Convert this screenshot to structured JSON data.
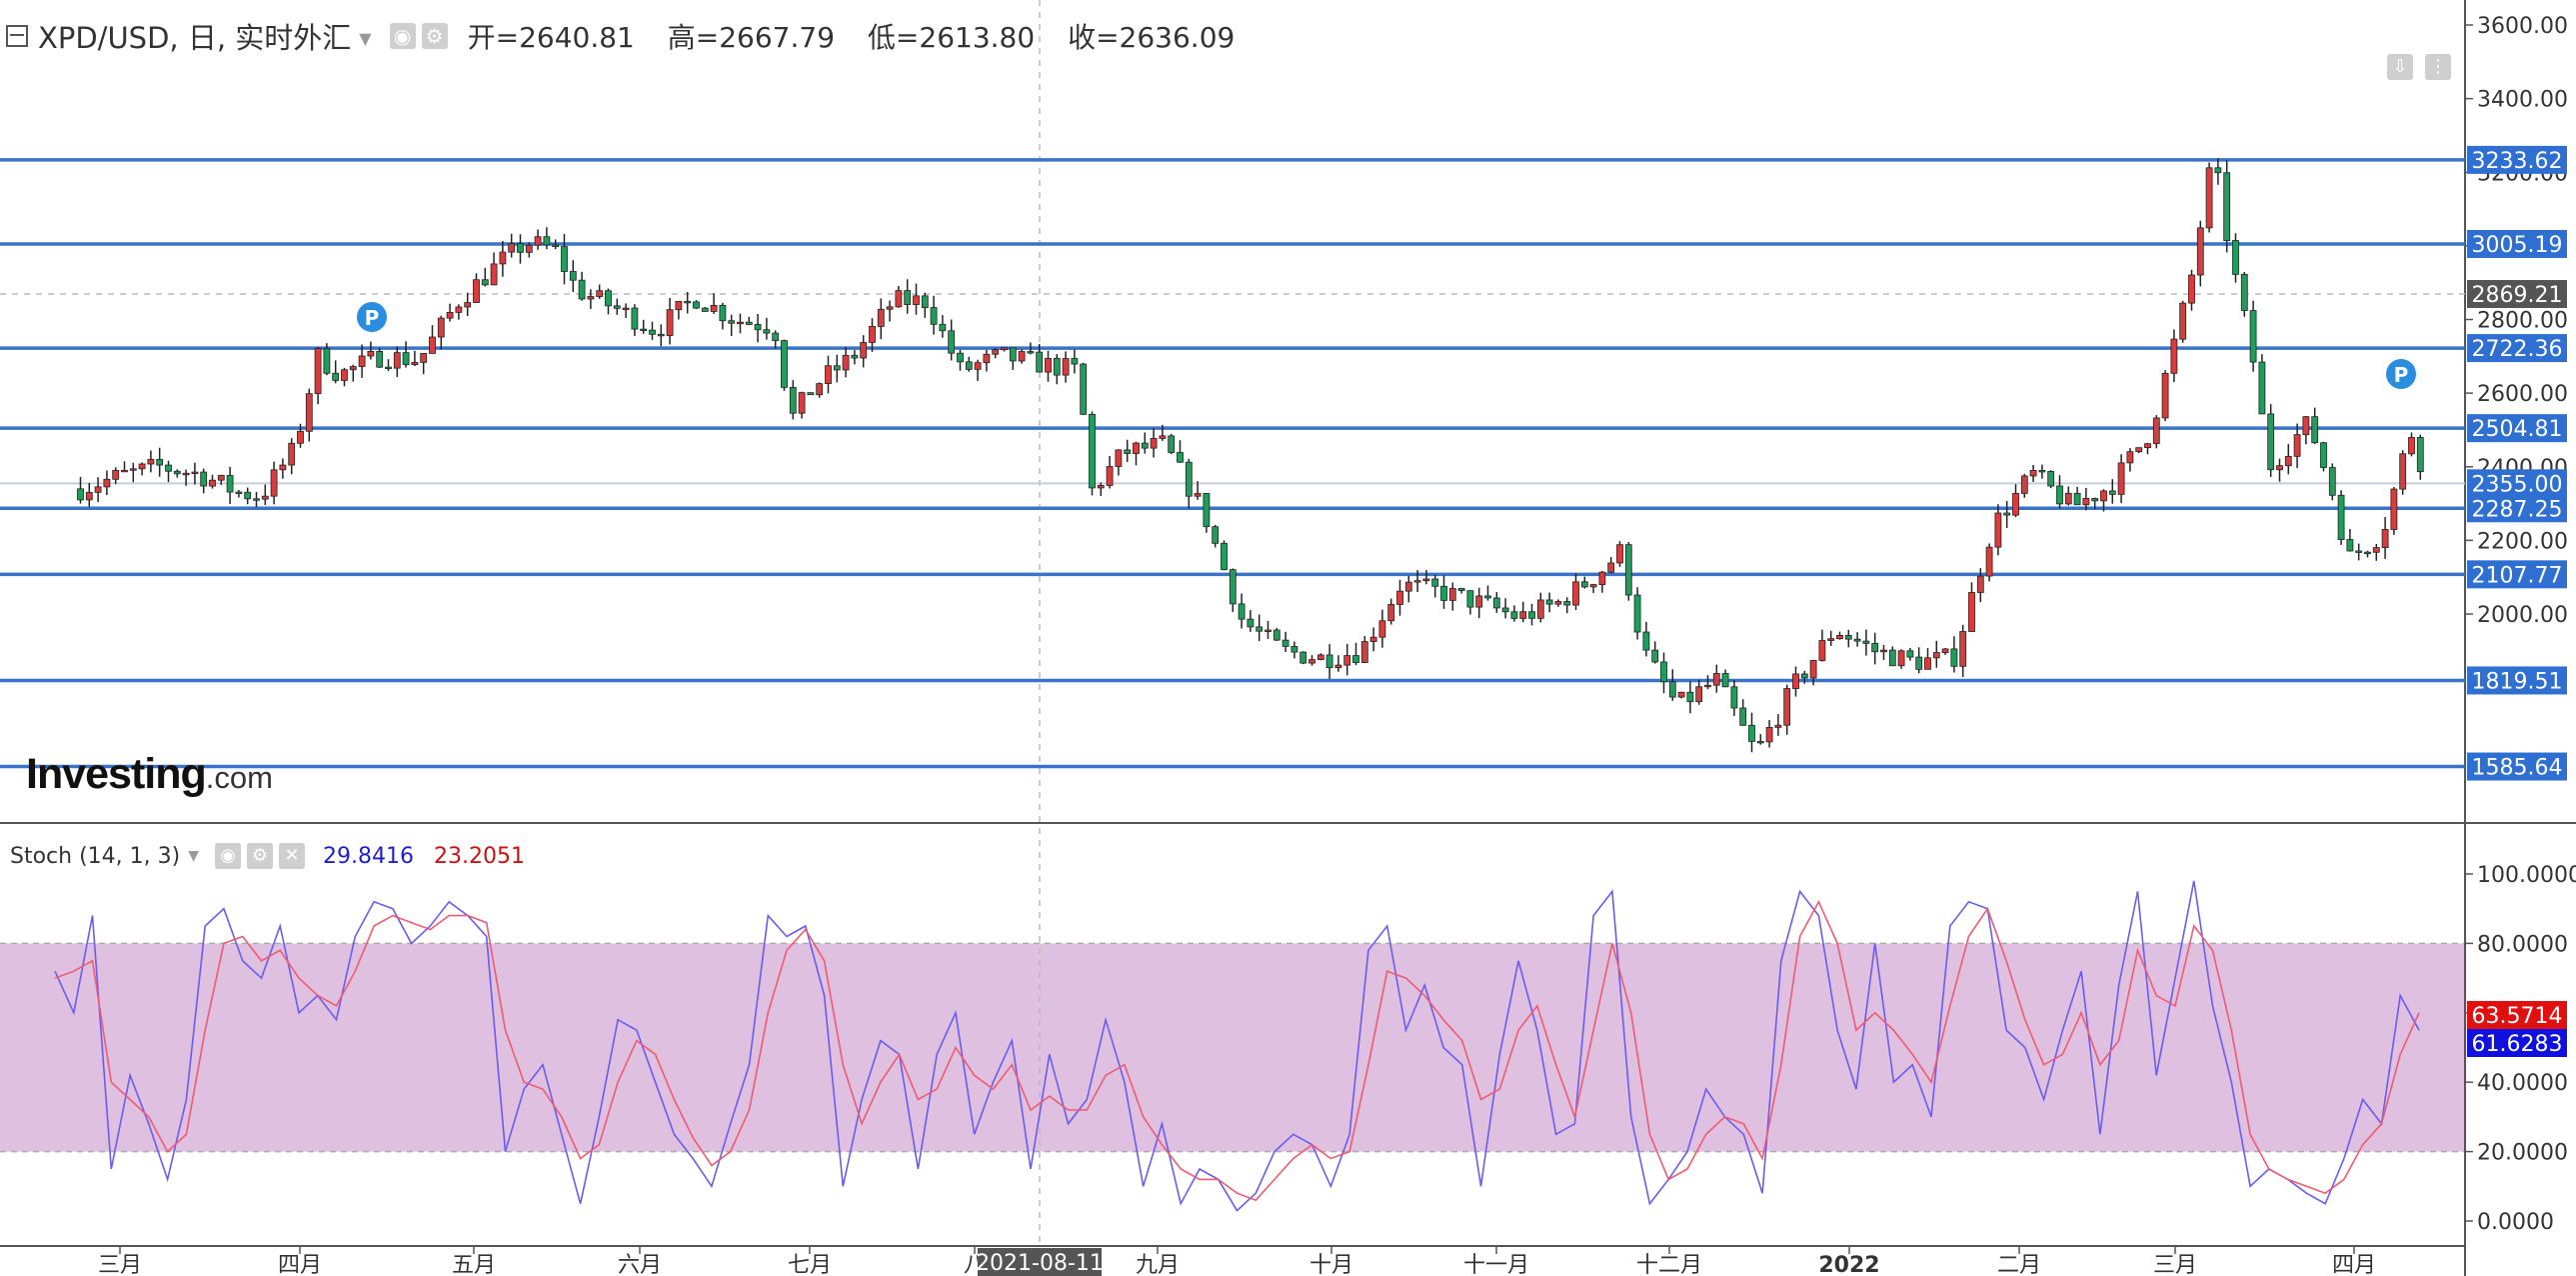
{
  "header": {
    "symbol": "XPD/USD, 日, 实时外汇",
    "open": "开=2640.81",
    "high": "高=2667.79",
    "low": "低=2613.80",
    "close": "收=2636.09"
  },
  "logo": {
    "brand": "Investing",
    "suffix": ".com"
  },
  "indicator": {
    "name": "Stoch (14, 1, 3)",
    "k_value": "29.8416",
    "d_value": "23.2051"
  },
  "crosshair_date": "2021-08-11",
  "colors": {
    "up": "#d93c3c",
    "down": "#1e9e5a",
    "support_line": "#3a73c9",
    "label_bg": "#2f6fd1",
    "k_line": "#6a5cf0",
    "d_line": "#ef5b70",
    "stoch_band": "#dfc0e0"
  },
  "chart_data": [
    {
      "type": "candlestick",
      "title": "XPD/USD, 日, 实时外汇",
      "ylim": [
        1500,
        3700
      ],
      "y_ticks": [
        2000,
        2200,
        2400,
        2600,
        2800,
        3000,
        3200,
        3400,
        3600
      ],
      "y_tick_labels": [
        "2000.00",
        "2200.00",
        "2400.00",
        "2600.00",
        "2800.00",
        "3000.00",
        "3200.00",
        "3400.00",
        "3600.00"
      ],
      "x_axis_labels": [
        "三月",
        "四月",
        "五月",
        "六月",
        "七月",
        "八",
        "九月",
        "十月",
        "十一月",
        "十二月",
        "2022",
        "二月",
        "三月",
        "四月"
      ],
      "horizontal_levels": [
        3233.62,
        3005.19,
        2722.36,
        2504.81,
        2287.25,
        2107.77,
        1819.51,
        1585.64
      ],
      "horizontal_level_labels": [
        "3233.62",
        "3005.19",
        "2722.36",
        "2504.81",
        "2287.25",
        "2107.77",
        "1819.51",
        "1585.64"
      ],
      "current_price": 2355.0,
      "current_price_label": "2355.00",
      "crosshair_price": 2869.21,
      "crosshair_price_label": "2869.21",
      "price_path": [
        {
          "date": "2021-02-22",
          "close": 2340
        },
        {
          "date": "2021-03-01",
          "close": 2375
        },
        {
          "date": "2021-03-08",
          "close": 2400
        },
        {
          "date": "2021-03-15",
          "close": 2380
        },
        {
          "date": "2021-03-22",
          "close": 2330
        },
        {
          "date": "2021-03-26",
          "close": 2320
        },
        {
          "date": "2021-04-01",
          "close": 2450
        },
        {
          "date": "2021-04-05",
          "close": 2700
        },
        {
          "date": "2021-04-09",
          "close": 2650
        },
        {
          "date": "2021-04-16",
          "close": 2700
        },
        {
          "date": "2021-04-23",
          "close": 2690
        },
        {
          "date": "2021-04-30",
          "close": 2850
        },
        {
          "date": "2021-05-07",
          "close": 2950
        },
        {
          "date": "2021-05-12",
          "close": 3010
        },
        {
          "date": "2021-05-17",
          "close": 2990
        },
        {
          "date": "2021-05-21",
          "close": 2880
        },
        {
          "date": "2021-05-28",
          "close": 2830
        },
        {
          "date": "2021-06-04",
          "close": 2770
        },
        {
          "date": "2021-06-11",
          "close": 2860
        },
        {
          "date": "2021-06-18",
          "close": 2800
        },
        {
          "date": "2021-06-25",
          "close": 2780
        },
        {
          "date": "2021-06-28",
          "close": 2530
        },
        {
          "date": "2021-07-02",
          "close": 2620
        },
        {
          "date": "2021-07-09",
          "close": 2700
        },
        {
          "date": "2021-07-16",
          "close": 2850
        },
        {
          "date": "2021-07-22",
          "close": 2850
        },
        {
          "date": "2021-07-28",
          "close": 2660
        },
        {
          "date": "2021-08-04",
          "close": 2700
        },
        {
          "date": "2021-08-11",
          "close": 2680
        },
        {
          "date": "2021-08-18",
          "close": 2660
        },
        {
          "date": "2021-08-20",
          "close": 2330
        },
        {
          "date": "2021-08-26",
          "close": 2440
        },
        {
          "date": "2021-09-02",
          "close": 2460
        },
        {
          "date": "2021-09-09",
          "close": 2280
        },
        {
          "date": "2021-09-16",
          "close": 1980
        },
        {
          "date": "2021-09-23",
          "close": 1900
        },
        {
          "date": "2021-09-30",
          "close": 1880
        },
        {
          "date": "2021-10-07",
          "close": 1900
        },
        {
          "date": "2021-10-14",
          "close": 2080
        },
        {
          "date": "2021-10-21",
          "close": 2060
        },
        {
          "date": "2021-10-28",
          "close": 2030
        },
        {
          "date": "2021-11-04",
          "close": 1990
        },
        {
          "date": "2021-11-11",
          "close": 2030
        },
        {
          "date": "2021-11-18",
          "close": 2110
        },
        {
          "date": "2021-11-22",
          "close": 2170
        },
        {
          "date": "2021-11-26",
          "close": 1900
        },
        {
          "date": "2021-12-02",
          "close": 1750
        },
        {
          "date": "2021-12-09",
          "close": 1820
        },
        {
          "date": "2021-12-16",
          "close": 1620
        },
        {
          "date": "2021-12-23",
          "close": 1810
        },
        {
          "date": "2021-12-30",
          "close": 1960
        },
        {
          "date": "2022-01-06",
          "close": 1900
        },
        {
          "date": "2022-01-13",
          "close": 1870
        },
        {
          "date": "2022-01-20",
          "close": 1880
        },
        {
          "date": "2022-01-27",
          "close": 2240
        },
        {
          "date": "2022-02-03",
          "close": 2380
        },
        {
          "date": "2022-02-10",
          "close": 2290
        },
        {
          "date": "2022-02-17",
          "close": 2350
        },
        {
          "date": "2022-02-24",
          "close": 2500
        },
        {
          "date": "2022-03-03",
          "close": 2900
        },
        {
          "date": "2022-03-07",
          "close": 3250
        },
        {
          "date": "2022-03-10",
          "close": 2980
        },
        {
          "date": "2022-03-14",
          "close": 2700
        },
        {
          "date": "2022-03-17",
          "close": 2400
        },
        {
          "date": "2022-03-24",
          "close": 2520
        },
        {
          "date": "2022-03-28",
          "close": 2340
        },
        {
          "date": "2022-03-31",
          "close": 2150
        },
        {
          "date": "2022-04-06",
          "close": 2220
        },
        {
          "date": "2022-04-11",
          "close": 2500
        },
        {
          "date": "2022-04-14",
          "close": 2356
        }
      ]
    },
    {
      "type": "line",
      "title": "Stoch (14, 1, 3)",
      "ylim": [
        0,
        100
      ],
      "y_ticks": [
        0,
        20,
        40,
        60,
        80,
        100
      ],
      "y_tick_labels": [
        "0.0000",
        "20.0000",
        "40.0000",
        "60.0000",
        "80.0000",
        "100.0000"
      ],
      "band": [
        20,
        80
      ],
      "last_d_label": "63.5714",
      "last_k_label": "61.6283",
      "series": [
        {
          "name": "k",
          "values": [
            72,
            60,
            88,
            15,
            42,
            28,
            12,
            35,
            85,
            90,
            75,
            70,
            85,
            60,
            65,
            58,
            82,
            92,
            90,
            80,
            85,
            92,
            88,
            82,
            20,
            38,
            45,
            25,
            5,
            30,
            58,
            55,
            40,
            25,
            18,
            10,
            28,
            45,
            88,
            82,
            85,
            65,
            10,
            35,
            52,
            48,
            15,
            48,
            60,
            25,
            40,
            52,
            15,
            48,
            28,
            35,
            58,
            40,
            10,
            28,
            5,
            15,
            12,
            3,
            8,
            20,
            25,
            22,
            10,
            25,
            78,
            85,
            55,
            68,
            50,
            45,
            10,
            48,
            75,
            55,
            25,
            28,
            88,
            95,
            30,
            5,
            12,
            20,
            38,
            30,
            25,
            8,
            75,
            95,
            88,
            55,
            38,
            80,
            40,
            45,
            30,
            85,
            92,
            90,
            55,
            50,
            35,
            55,
            72,
            25,
            68,
            95,
            42,
            70,
            98,
            62,
            40,
            10,
            15,
            12,
            8,
            5,
            18,
            35,
            28,
            65,
            55
          ]
        },
        {
          "name": "d",
          "values": [
            70,
            72,
            75,
            40,
            35,
            30,
            20,
            25,
            55,
            80,
            82,
            75,
            78,
            70,
            65,
            62,
            72,
            85,
            88,
            86,
            84,
            88,
            88,
            86,
            55,
            40,
            38,
            30,
            18,
            22,
            40,
            52,
            48,
            35,
            24,
            16,
            20,
            32,
            60,
            78,
            84,
            75,
            45,
            28,
            40,
            48,
            35,
            38,
            50,
            42,
            38,
            45,
            32,
            36,
            32,
            32,
            42,
            45,
            30,
            22,
            15,
            12,
            12,
            8,
            6,
            12,
            18,
            22,
            18,
            20,
            45,
            72,
            70,
            65,
            58,
            52,
            35,
            38,
            55,
            62,
            45,
            30,
            55,
            80,
            60,
            25,
            12,
            15,
            25,
            30,
            28,
            18,
            45,
            82,
            92,
            80,
            55,
            60,
            55,
            48,
            40,
            62,
            82,
            90,
            75,
            58,
            45,
            48,
            60,
            45,
            52,
            78,
            65,
            62,
            85,
            78,
            55,
            25,
            15,
            12,
            10,
            8,
            12,
            22,
            28,
            48,
            60
          ]
        }
      ]
    }
  ]
}
